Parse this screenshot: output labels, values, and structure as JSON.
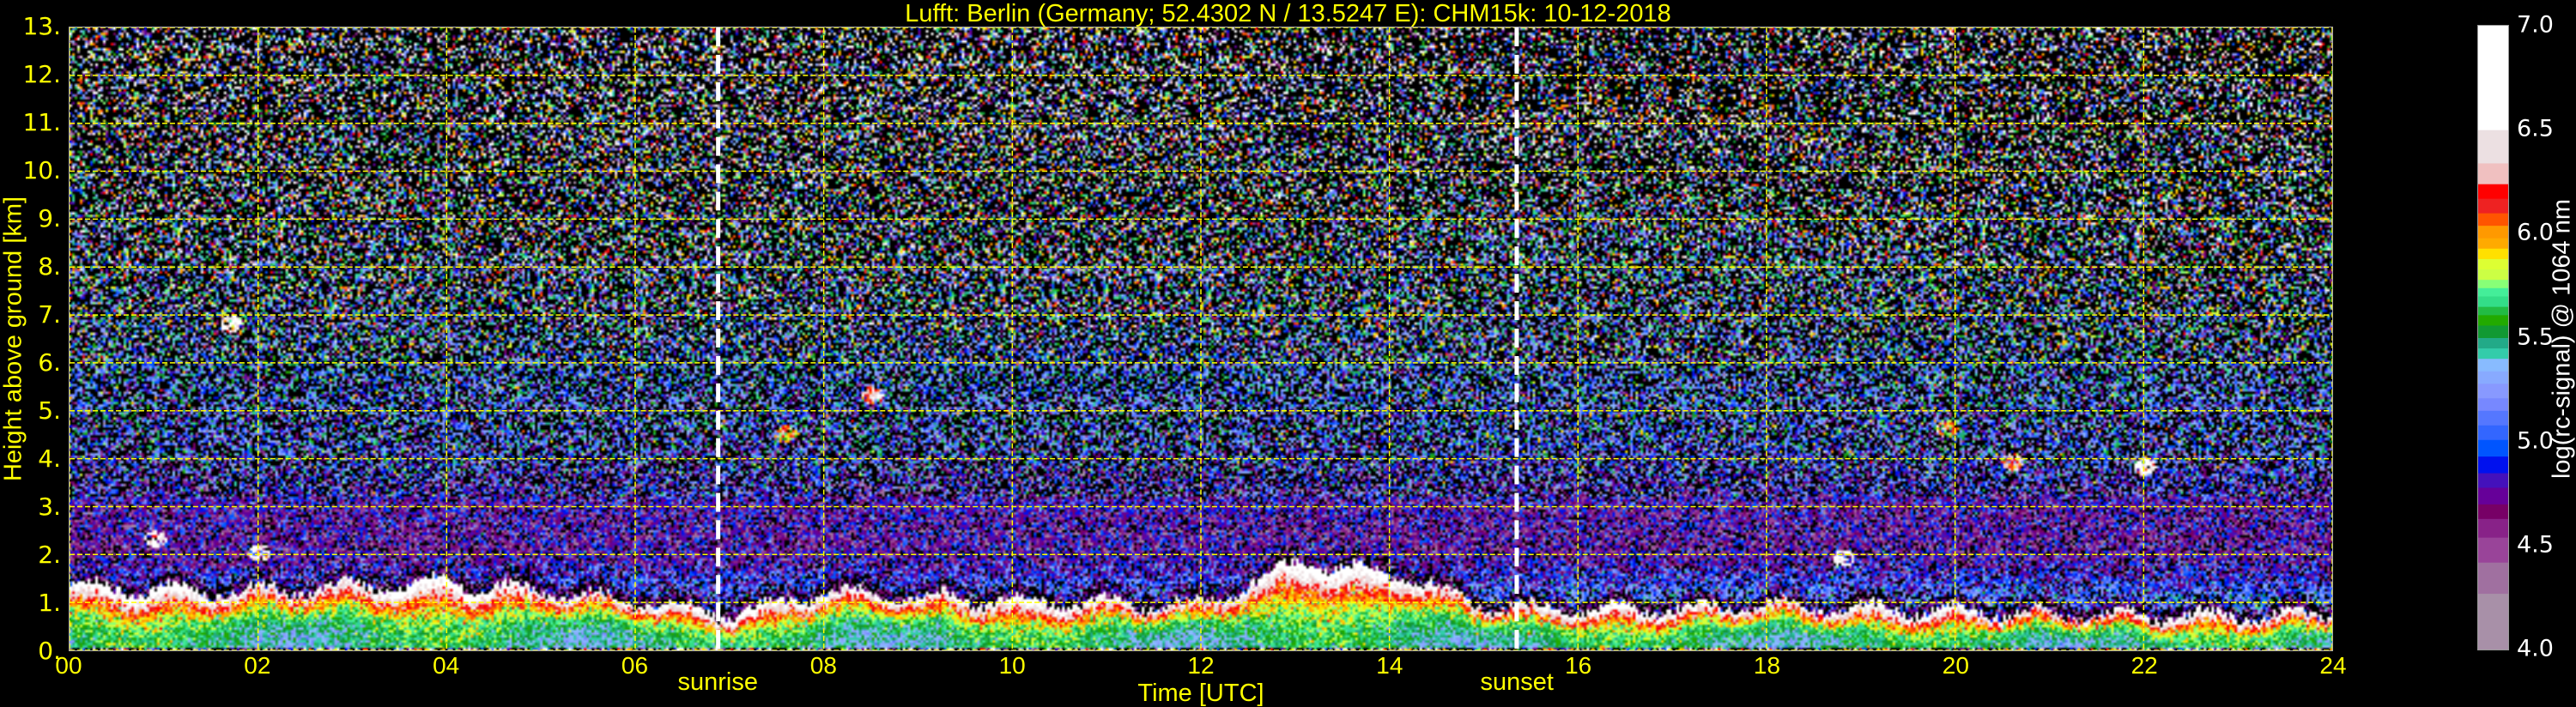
{
  "chart_data": {
    "type": "heatmap",
    "title": "Lufft: Berlin (Germany; 52.4302 N / 13.5247 E):    CHM15k: 10-12-2018",
    "xlabel": "Time [UTC]",
    "ylabel": "Height above ground [km]",
    "xlim": [
      0,
      24
    ],
    "ylim": [
      0,
      13
    ],
    "x_ticks": [
      0,
      2,
      4,
      6,
      8,
      10,
      12,
      14,
      16,
      18,
      20,
      22,
      24
    ],
    "x_tick_labels": [
      "00",
      "02",
      "04",
      "06",
      "08",
      "10",
      "12",
      "14",
      "16",
      "18",
      "20",
      "22",
      "24"
    ],
    "y_ticks": [
      0,
      1,
      2,
      3,
      4,
      5,
      6,
      7,
      8,
      9,
      10,
      11,
      12,
      13
    ],
    "y_tick_labels": [
      "0.",
      "1.",
      "2.",
      "3.",
      "4.",
      "5.",
      "6.",
      "7.",
      "8.",
      "9.",
      "10.",
      "11.",
      "12.",
      "13."
    ],
    "grid": {
      "on": true,
      "color": "#ffff00",
      "x_step_hours": 2,
      "y_step_km": 1
    },
    "annotations": [
      {
        "label": "sunrise",
        "time_utc": 6.88
      },
      {
        "label": "sunset",
        "time_utc": 15.35
      }
    ],
    "colorbar": {
      "label": "log(rc-signal) @ 1064 nm",
      "range": [
        4.0,
        7.0
      ],
      "ticks": [
        4.0,
        4.5,
        5.0,
        5.5,
        6.0,
        6.5,
        7.0
      ],
      "tick_labels": [
        "4.0",
        "4.5",
        "5.0",
        "5.5",
        "6.0",
        "6.5",
        "7.0"
      ],
      "under_color": "#000000",
      "bounds": [
        4.0,
        4.27,
        4.42,
        4.54,
        4.63,
        4.7,
        4.78,
        4.85,
        4.93,
        5.01,
        5.08,
        5.15,
        5.21,
        5.28,
        5.34,
        5.4,
        5.45,
        5.5,
        5.56,
        5.61,
        5.65,
        5.7,
        5.74,
        5.78,
        5.83,
        5.88,
        5.93,
        5.98,
        6.04,
        6.1,
        6.17,
        6.24,
        6.34,
        6.5,
        7.0
      ],
      "colors": [
        "#a890a8",
        "#a070a0",
        "#994499",
        "#882288",
        "#770066",
        "#660099",
        "#4411bb",
        "#0011ee",
        "#0055ff",
        "#3366ff",
        "#5577ff",
        "#7788ff",
        "#8899ff",
        "#88aaff",
        "#88bbff",
        "#33ccaa",
        "#22aa88",
        "#119933",
        "#22aa00",
        "#22bb44",
        "#33dd88",
        "#44ee99",
        "#88ff77",
        "#ccff44",
        "#ddff33",
        "#ffe000",
        "#ffaa00",
        "#ff9900",
        "#ff5500",
        "#ee2222",
        "#ff0000",
        "#f0c0c0",
        "#ece0e2",
        "#ffffff"
      ]
    },
    "profile": {
      "boundary_layer_top_km": [
        [
          0,
          1.3
        ],
        [
          2,
          1.2
        ],
        [
          4,
          1.4
        ],
        [
          6,
          1.0
        ],
        [
          7,
          0.7
        ],
        [
          8,
          1.2
        ],
        [
          10,
          1.0
        ],
        [
          12,
          0.9
        ],
        [
          13,
          1.8
        ],
        [
          14,
          1.6
        ],
        [
          15,
          0.9
        ],
        [
          16,
          0.8
        ],
        [
          18,
          0.9
        ],
        [
          20,
          0.8
        ],
        [
          22,
          0.7
        ],
        [
          24,
          0.7
        ]
      ],
      "cloud_features": [
        {
          "time_utc": 1.7,
          "height_km": 6.8,
          "value": 6.6
        },
        {
          "time_utc": 2.0,
          "height_km": 2.0,
          "value": 6.6
        },
        {
          "time_utc": 0.9,
          "height_km": 2.3,
          "value": 6.6
        },
        {
          "time_utc": 8.5,
          "height_km": 5.3,
          "value": 6.3
        },
        {
          "time_utc": 7.6,
          "height_km": 4.5,
          "value": 6.0
        },
        {
          "time_utc": 18.8,
          "height_km": 1.9,
          "value": 6.6
        },
        {
          "time_utc": 20.6,
          "height_km": 3.9,
          "value": 6.2
        },
        {
          "time_utc": 22.0,
          "height_km": 3.8,
          "value": 6.5
        },
        {
          "time_utc": 19.9,
          "height_km": 4.6,
          "value": 6.0
        }
      ],
      "background_mean_by_height": [
        [
          0,
          5.6
        ],
        [
          2,
          4.7
        ],
        [
          3,
          4.75
        ],
        [
          4,
          5.05
        ],
        [
          6,
          5.2
        ],
        [
          8,
          5.35
        ],
        [
          13,
          5.45
        ]
      ]
    }
  }
}
